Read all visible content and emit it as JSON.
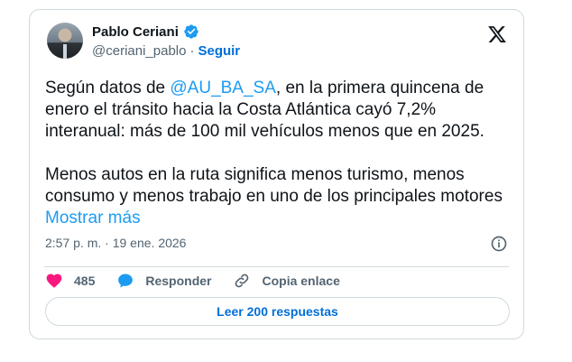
{
  "author": {
    "name": "Pablo Ceriani",
    "handle": "@ceriani_pablo",
    "separator": "·",
    "follow_label": "Seguir"
  },
  "tweet": {
    "paragraph1_prefix": "Según datos de ",
    "mention": "@AU_BA_SA",
    "paragraph1_suffix": ", en la primera quincena de enero el tránsito hacia la Costa Atlántica cayó 7,2% interanual: más de 100 mil vehículos menos que en 2025.",
    "paragraph2": "Menos autos en la ruta significa menos turismo, menos consumo y menos trabajo en uno de los principales motores ",
    "show_more": "Mostrar más"
  },
  "meta": {
    "time": "2:57 p. m.",
    "separator": "·",
    "date": "19 ene. 2026"
  },
  "actions": {
    "likes": "485",
    "reply_label": "Responder",
    "copy_label": "Copia enlace"
  },
  "read_replies_label": "Leer 200 respuestas",
  "colors": {
    "accent": "#1d9bf0",
    "link_blue": "#006fd6",
    "like_pink": "#f91880",
    "muted": "#536471",
    "border": "#cfd9de"
  },
  "icons": [
    "verified-badge-icon",
    "x-logo-icon",
    "info-icon",
    "heart-icon",
    "reply-bubble-icon",
    "link-icon"
  ]
}
